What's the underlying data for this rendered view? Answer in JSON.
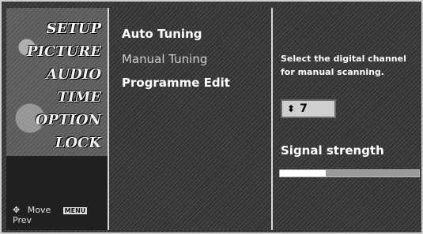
{
  "menu": {
    "items": [
      {
        "label": "SETUP"
      },
      {
        "label": "PICTURE"
      },
      {
        "label": "AUDIO"
      },
      {
        "label": "TIME"
      },
      {
        "label": "OPTION"
      },
      {
        "label": "LOCK"
      }
    ],
    "footer": {
      "move_label": "Move",
      "menu_key": "MENU",
      "prev_label": "Prev"
    }
  },
  "submenu": {
    "items": [
      {
        "label": "Auto Tuning"
      },
      {
        "label": "Manual Tuning"
      },
      {
        "label": "Programme Edit"
      }
    ]
  },
  "info": {
    "description": "Select the digital channel for manual scanning.",
    "channel": "7",
    "signal_label": "Signal strength",
    "signal_level": 0.33
  }
}
